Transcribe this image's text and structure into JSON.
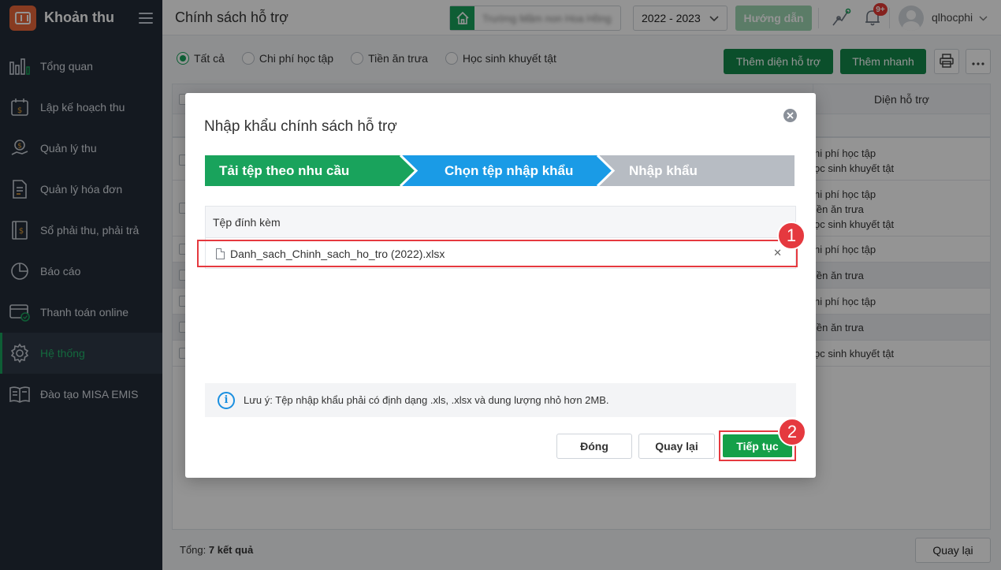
{
  "app": {
    "title": "Khoản thu"
  },
  "sidebar": {
    "items": [
      {
        "label": "Tổng quan",
        "icon": "dashboard-icon"
      },
      {
        "label": "Lập kế hoạch thu",
        "icon": "calendar-dollar-icon"
      },
      {
        "label": "Quản lý thu",
        "icon": "money-hand-icon"
      },
      {
        "label": "Quản lý hóa đơn",
        "icon": "invoice-icon"
      },
      {
        "label": "Sổ phải thu, phải trả",
        "icon": "ledger-icon"
      },
      {
        "label": "Báo cáo",
        "icon": "pie-chart-icon"
      },
      {
        "label": "Thanh toán online",
        "icon": "online-payment-icon"
      },
      {
        "label": "Hệ thống",
        "icon": "gear-icon",
        "active": true
      },
      {
        "label": "Đào tạo MISA EMIS",
        "icon": "book-icon"
      }
    ]
  },
  "header": {
    "page_title": "Chính sách hỗ trợ",
    "school_name": "Trường Mầm non Hoa Hồng",
    "year": "2022 - 2023",
    "guide_label": "Hướng dẫn",
    "notification_count": "9+",
    "username": "qlhocphi"
  },
  "toolbar": {
    "filters": [
      {
        "label": "Tất cả",
        "checked": true
      },
      {
        "label": "Chi phí học tập",
        "checked": false
      },
      {
        "label": "Tiền ăn trưa",
        "checked": false
      },
      {
        "label": "Học sinh khuyết tật",
        "checked": false
      }
    ],
    "add_label": "Thêm diện hỗ trợ",
    "quick_add_label": "Thêm nhanh"
  },
  "table": {
    "header_col": "Diện hỗ trợ",
    "rows": [
      {
        "lines": [
          "hi phí học tập",
          "ọc sinh khuyết tật"
        ]
      },
      {
        "lines": [
          "hi phí học tập",
          "iền ăn trưa",
          "ọc sinh khuyết tật"
        ]
      },
      {
        "lines": [
          "hi phí học tập"
        ]
      },
      {
        "lines": [
          "iền ăn trưa"
        ]
      },
      {
        "lines": [
          "hi phí học tập"
        ]
      },
      {
        "lines": [
          "iền ăn trưa"
        ]
      },
      {
        "lines": [
          "ọc sinh khuyết tật"
        ]
      }
    ],
    "total_label": "Tổng:",
    "total_value": "7 kết quả",
    "back_label": "Quay lại"
  },
  "modal": {
    "title": "Nhập khẩu chính sách hỗ trợ",
    "steps": [
      {
        "label": "Tải tệp theo nhu cầu",
        "color": "#19a35c"
      },
      {
        "label": "Chọn tệp nhập khẩu",
        "color": "#1a9be6"
      },
      {
        "label": "Nhập khẩu",
        "color": "#b7bcc3"
      }
    ],
    "attachment_header": "Tệp đính kèm",
    "file_name": "Danh_sach_Chinh_sach_ho_tro (2022).xlsx",
    "note": "Lưu ý: Tệp nhập khẩu phải có định dạng .xls, .xlsx và dung lượng nhỏ hơn 2MB.",
    "close_label": "Đóng",
    "back_label": "Quay lại",
    "next_label": "Tiếp tục",
    "callouts": [
      "1",
      "2"
    ]
  },
  "colors": {
    "brand": "#e8663a",
    "primary_green": "#19a35c",
    "active_blue": "#1a9be6",
    "highlight_red": "#e5393f",
    "sidebar_bg": "#232b37"
  }
}
